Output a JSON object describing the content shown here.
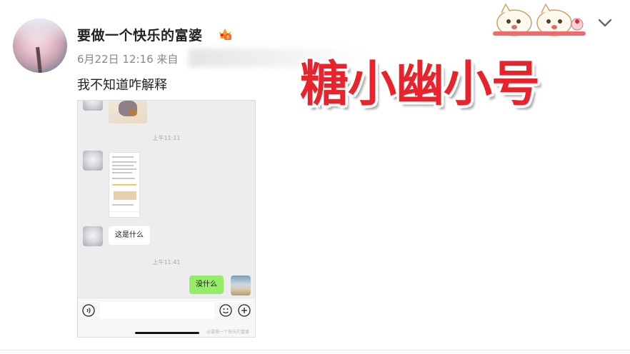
{
  "post": {
    "username": "要做一个快乐的富婆",
    "date_time": "6月22日 12:16",
    "source_prefix": "来自",
    "text": "我不知道咋解释"
  },
  "watermark": "糖小幽小号",
  "chat_screenshot": {
    "time_1": "上午11:11",
    "bubble_incoming": "这是什么",
    "time_2": "上午11:41",
    "bubble_outgoing": "没什么",
    "footer_watermark": "@要做一个快乐的富婆"
  },
  "icons": [
    "avatar",
    "vip-badge-icon",
    "sticker-icon",
    "chevron-down-icon",
    "voice-icon",
    "emoji-icon",
    "plus-icon"
  ],
  "colors": {
    "watermark_red": "#e8232b",
    "outgoing_bubble": "#95ec69",
    "chat_background": "#ededed"
  }
}
